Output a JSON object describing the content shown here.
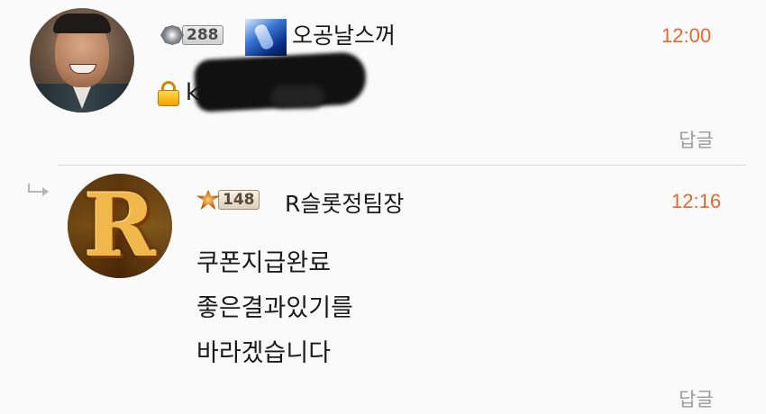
{
  "comments": [
    {
      "level": "288",
      "nickname": "오공날스꺼",
      "time": "12:00",
      "secret_text": "k",
      "reply_label": "답글"
    },
    {
      "level": "148",
      "nickname": "R슬롯정팀장",
      "time": "12:16",
      "body_lines": [
        "쿠폰지급완료",
        "좋은결과있기를",
        "바라겠습니다"
      ],
      "reply_label": "답글",
      "avatar_letter": "R"
    }
  ],
  "colors": {
    "time": "#e8692b",
    "reply_link": "#9a9a9a",
    "background": "#fafafa"
  },
  "icons": {
    "secret": "lock-icon",
    "reply_indicator": "reply-arrow-icon"
  }
}
